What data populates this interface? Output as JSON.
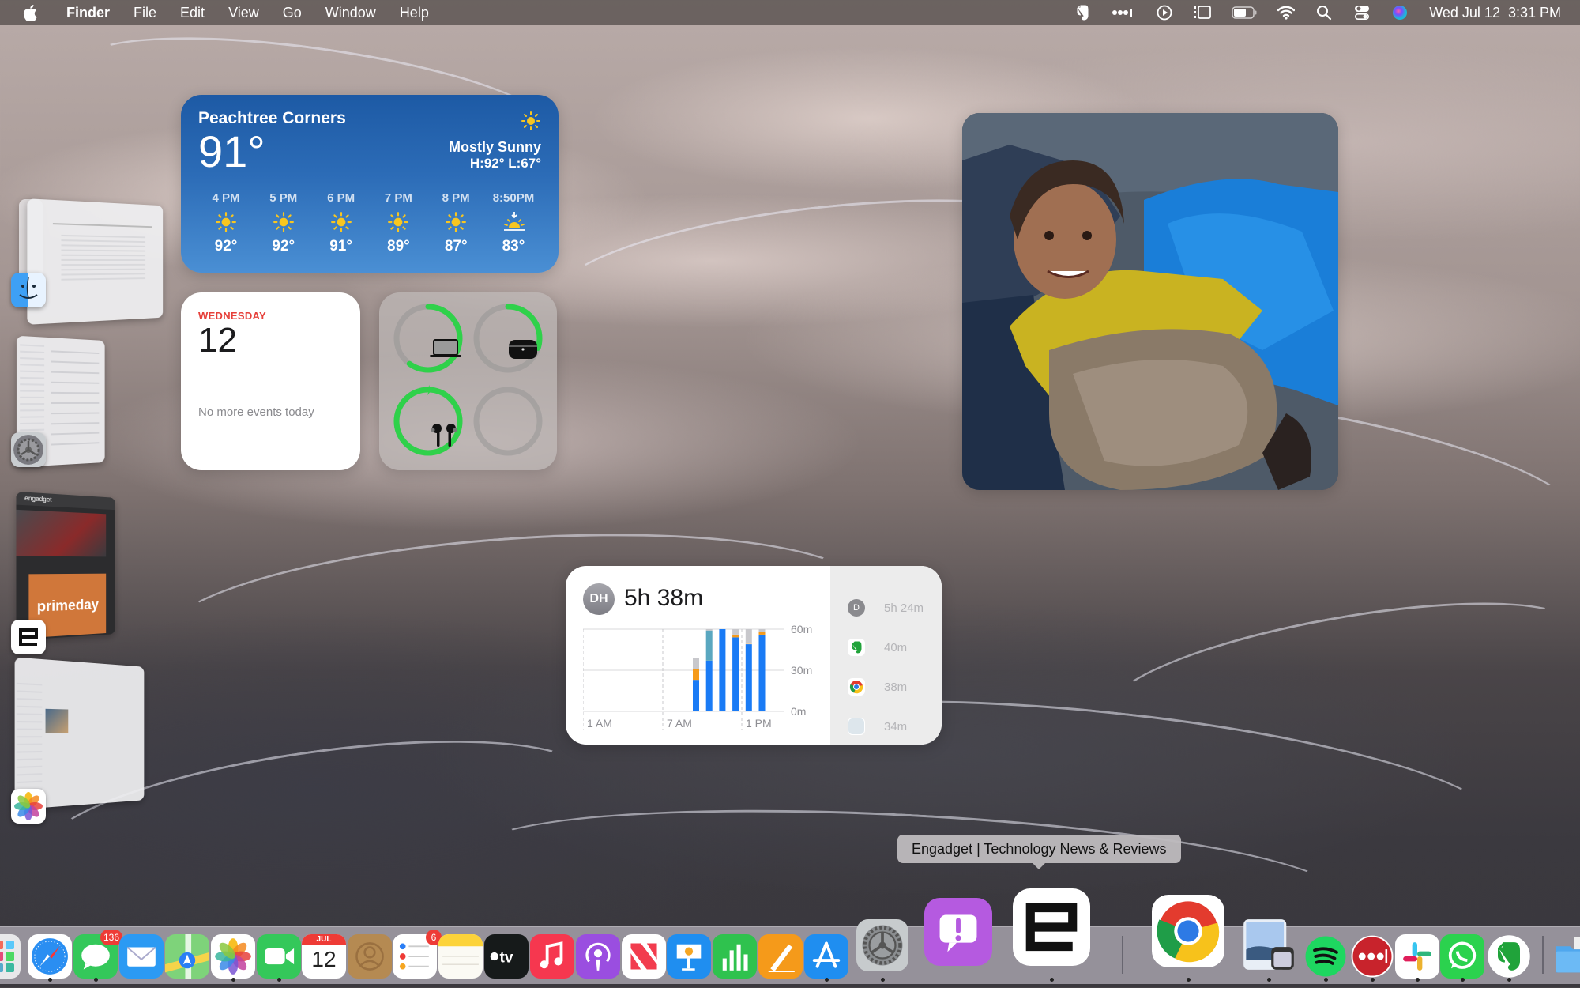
{
  "menubar": {
    "app_name": "Finder",
    "menus": [
      "File",
      "Edit",
      "View",
      "Go",
      "Window",
      "Help"
    ],
    "status_icons": [
      "evernote-icon",
      "lastpass-icon",
      "play-circle-icon",
      "stage-manager-icon",
      "battery-icon",
      "wifi-icon",
      "search-icon",
      "control-center-icon",
      "siri-icon"
    ],
    "datetime": "Wed Jul 12  3:31 PM"
  },
  "weather": {
    "city": "Peachtree Corners",
    "temp": "91°",
    "condition": "Mostly Sunny",
    "high_low": "H:92° L:67°",
    "hourly": [
      {
        "time": "4 PM",
        "icon": "sun",
        "temp": "92°"
      },
      {
        "time": "5 PM",
        "icon": "sun",
        "temp": "92°"
      },
      {
        "time": "6 PM",
        "icon": "sun",
        "temp": "91°"
      },
      {
        "time": "7 PM",
        "icon": "sun",
        "temp": "89°"
      },
      {
        "time": "8 PM",
        "icon": "sun",
        "temp": "87°"
      },
      {
        "time": "8:50PM",
        "icon": "sunset",
        "temp": "83°"
      }
    ]
  },
  "calendar": {
    "weekday": "WEDNESDAY",
    "day": "12",
    "empty_message": "No more events today"
  },
  "batteries": {
    "devices": [
      {
        "name": "MacBook",
        "icon": "laptop-icon",
        "level": 0.6
      },
      {
        "name": "AirPods Case",
        "icon": "airpods-case-icon",
        "level": 0.3
      },
      {
        "name": "AirPods",
        "icon": "airpods-icon",
        "level": 1.0,
        "charging": true
      },
      {
        "name": "Empty",
        "icon": "",
        "level": 0
      }
    ],
    "color": "#2fd14a"
  },
  "screen_time": {
    "avatar": "DH",
    "total": "5h 38m",
    "chart": {
      "y_ticks": [
        "60m",
        "30m",
        "0m"
      ],
      "x_ticks": [
        "1 AM",
        "7 AM",
        "1 PM"
      ],
      "bars": [
        {
          "hour": "9 AM",
          "segments": [
            {
              "color": "#1a7bf5",
              "value": 23
            },
            {
              "color": "#f59a1a",
              "value": 8
            },
            {
              "color": "#c8c8cc",
              "value": 8
            }
          ]
        },
        {
          "hour": "10 AM",
          "segments": [
            {
              "color": "#1a7bf5",
              "value": 37
            },
            {
              "color": "#5aa7c0",
              "value": 22
            },
            {
              "color": "#c8c8cc",
              "value": 1
            }
          ]
        },
        {
          "hour": "11 AM",
          "segments": [
            {
              "color": "#1a7bf5",
              "value": 60
            }
          ]
        },
        {
          "hour": "12 PM",
          "segments": [
            {
              "color": "#1a7bf5",
              "value": 54
            },
            {
              "color": "#f59a1a",
              "value": 2
            },
            {
              "color": "#c8c8cc",
              "value": 4
            }
          ]
        },
        {
          "hour": "1 PM",
          "segments": [
            {
              "color": "#1a7bf5",
              "value": 49
            },
            {
              "color": "#e8d0b0",
              "value": 1
            },
            {
              "color": "#c8c8cc",
              "value": 10
            }
          ]
        },
        {
          "hour": "2 PM",
          "segments": [
            {
              "color": "#1a7bf5",
              "value": 56
            },
            {
              "color": "#f59a1a",
              "value": 2
            },
            {
              "color": "#c8c8cc",
              "value": 2
            }
          ]
        }
      ],
      "y_max": 60
    },
    "apps": [
      {
        "icon": "d-avatar-icon",
        "label": "D",
        "time": "5h 24m"
      },
      {
        "icon": "evernote-icon",
        "label": "",
        "time": "40m"
      },
      {
        "icon": "chrome-icon",
        "label": "",
        "time": "38m"
      },
      {
        "icon": "generic-app-icon",
        "label": "",
        "time": "34m"
      }
    ]
  },
  "stage_manager": [
    {
      "app": "Finder",
      "icon": "finder-icon"
    },
    {
      "app": "System Settings",
      "icon": "settings-icon"
    },
    {
      "app": "Engadget",
      "icon": "engadget-icon",
      "thumb_text": [
        "engadget",
        "primeday"
      ]
    },
    {
      "app": "Photos",
      "icon": "photos-icon"
    }
  ],
  "tooltip": "Engadget | Technology News & Reviews",
  "dock": {
    "items": [
      {
        "name": "Launchpad",
        "icon": "launchpad-icon",
        "running": false
      },
      {
        "name": "Safari",
        "icon": "safari-icon",
        "running": true
      },
      {
        "name": "Messages",
        "icon": "messages-icon",
        "running": true,
        "badge": "136"
      },
      {
        "name": "Mail",
        "icon": "mail-icon",
        "running": false
      },
      {
        "name": "Maps",
        "icon": "maps-icon",
        "running": false
      },
      {
        "name": "Photos",
        "icon": "photos-icon",
        "running": true
      },
      {
        "name": "FaceTime",
        "icon": "facetime-icon",
        "running": true
      },
      {
        "name": "Calendar",
        "icon": "calendar-icon",
        "running": false,
        "month": "JUL",
        "day": "12"
      },
      {
        "name": "Contacts",
        "icon": "contacts-icon",
        "running": false
      },
      {
        "name": "Reminders",
        "icon": "reminders-icon",
        "running": false,
        "badge": "6"
      },
      {
        "name": "Notes",
        "icon": "notes-icon",
        "running": false
      },
      {
        "name": "TV",
        "icon": "tv-icon",
        "running": false,
        "label": "tv"
      },
      {
        "name": "Music",
        "icon": "music-icon",
        "running": false
      },
      {
        "name": "Podcasts",
        "icon": "podcasts-icon",
        "running": false
      },
      {
        "name": "News",
        "icon": "news-icon",
        "running": false
      },
      {
        "name": "Keynote",
        "icon": "keynote-icon",
        "running": false
      },
      {
        "name": "Numbers",
        "icon": "numbers-icon",
        "running": false
      },
      {
        "name": "Pages",
        "icon": "pages-icon",
        "running": false
      },
      {
        "name": "App Store",
        "icon": "app-store-icon",
        "running": true
      },
      {
        "name": "System Settings",
        "icon": "settings-icon",
        "running": true
      },
      {
        "name": "Feedback Assistant",
        "icon": "feedback-icon",
        "running": false
      },
      {
        "name": "Engadget",
        "icon": "engadget-icon",
        "running": true
      },
      {
        "name": "Chrome",
        "icon": "chrome-icon",
        "running": true
      },
      {
        "name": "Preview",
        "icon": "preview-icon",
        "running": true
      },
      {
        "name": "Spotify",
        "icon": "spotify-icon",
        "running": true
      },
      {
        "name": "LastPass",
        "icon": "lastpass-icon",
        "running": true
      },
      {
        "name": "Slack",
        "icon": "slack-icon",
        "running": true
      },
      {
        "name": "WhatsApp",
        "icon": "whatsapp-icon",
        "running": true
      },
      {
        "name": "Evernote",
        "icon": "evernote-icon",
        "running": true
      },
      {
        "name": "Downloads",
        "icon": "folder-icon",
        "running": false
      }
    ]
  }
}
